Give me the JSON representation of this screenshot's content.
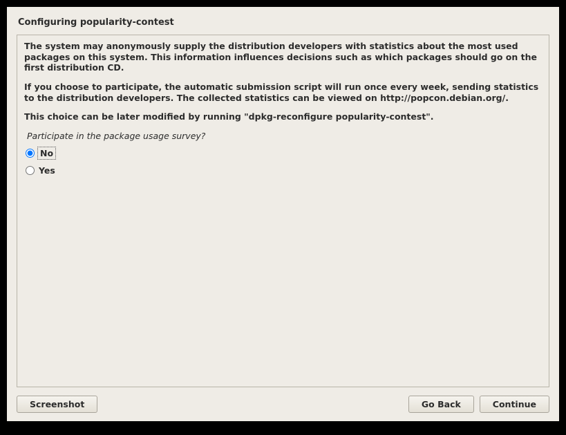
{
  "title": "Configuring popularity-contest",
  "paragraphs": [
    "The system may anonymously supply the distribution developers with statistics about the most used packages on this system. This information influences decisions such as which packages should go on the first distribution CD.",
    "If you choose to participate, the automatic submission script will run once every week, sending statistics to the distribution developers. The collected statistics can be viewed on http://popcon.debian.org/.",
    "This choice can be later modified by running \"dpkg-reconfigure popularity-contest\"."
  ],
  "question": "Participate in the package usage survey?",
  "options": {
    "no": "No",
    "yes": "Yes"
  },
  "selected": "no",
  "buttons": {
    "screenshot": "Screenshot",
    "go_back": "Go Back",
    "continue": "Continue"
  }
}
